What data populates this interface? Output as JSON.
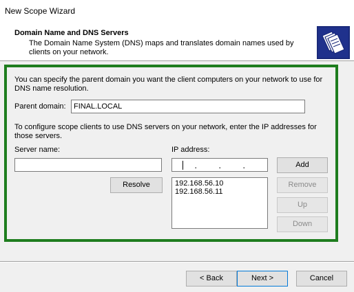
{
  "window": {
    "title": "New Scope Wizard"
  },
  "header": {
    "title": "Domain Name and DNS Servers",
    "subtitle": "The Domain Name System (DNS) maps and translates domain names used by clients on your network.",
    "icon": "wizard-folders-icon"
  },
  "domain": {
    "intro": "You can specify the parent domain you want the client computers on your network to use for DNS name resolution.",
    "label": "Parent domain:",
    "value": "FINAL.LOCAL"
  },
  "dns": {
    "intro": "To configure scope clients to use DNS servers on your network, enter the IP addresses for those servers.",
    "server_name_label": "Server name:",
    "server_name_value": "",
    "ip_address_label": "IP address:",
    "ip_address_value": "",
    "resolve_label": "Resolve",
    "add_label": "Add",
    "remove_label": "Remove",
    "up_label": "Up",
    "down_label": "Down",
    "servers": [
      "192.168.56.10",
      "192.168.56.11"
    ]
  },
  "footer": {
    "back_label": "< Back",
    "next_label": "Next >",
    "cancel_label": "Cancel"
  },
  "colors": {
    "highlight_frame": "#1e7d1e"
  }
}
